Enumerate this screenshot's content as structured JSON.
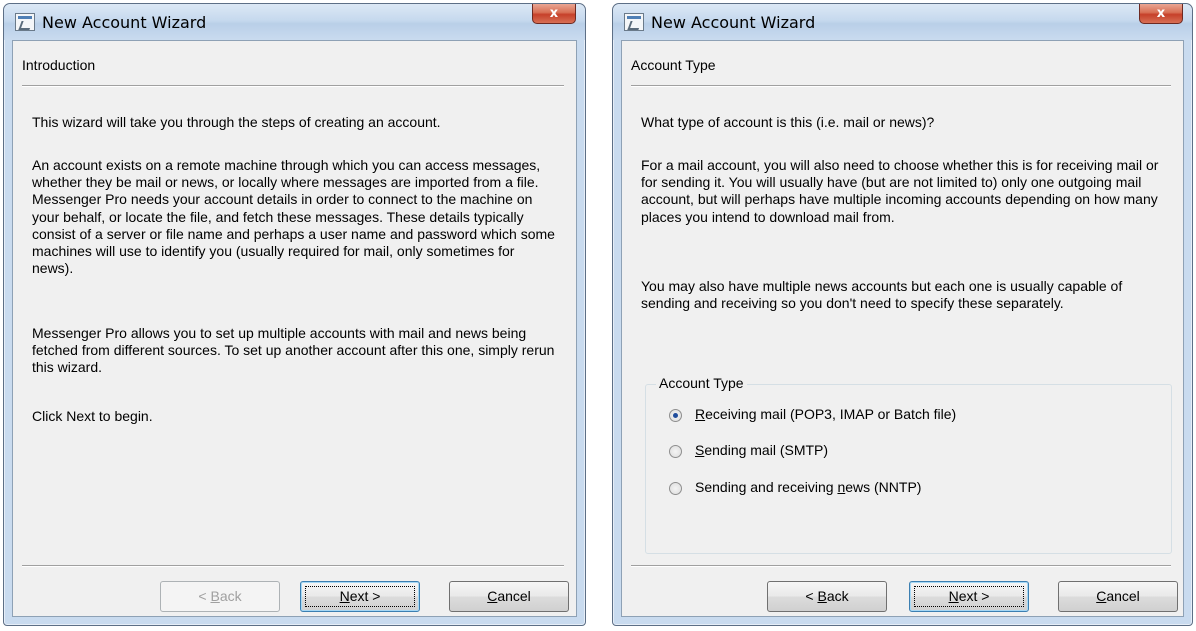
{
  "windows": [
    {
      "title": "New Account Wizard",
      "close_label": "x",
      "page_header": "Introduction",
      "paragraphs": [
        "This wizard will take you through the steps of creating an account.",
        "An account exists on a remote machine through which you can access messages, whether they be mail or news, or locally where messages are imported from a file.  Messenger Pro needs your account details in order to connect to the machine on your behalf, or locate the file, and fetch these messages.  These details typically consist of a server or file name and perhaps a user name and password which some machines will use to identify you (usually required for mail, only sometimes for news).",
        "Messenger Pro allows you to set up multiple accounts with mail and news being fetched from different sources.  To set up another account after this one, simply rerun this wizard.",
        "Click Next to begin."
      ],
      "buttons": {
        "back": {
          "label": "< Back",
          "mnemonic": "B",
          "enabled": false
        },
        "next": {
          "label": "Next >",
          "mnemonic": "N",
          "default": true
        },
        "cancel": {
          "label": "Cancel",
          "mnemonic": "C"
        }
      }
    },
    {
      "title": "New Account Wizard",
      "close_label": "x",
      "page_header": "Account Type",
      "paragraphs": [
        "What type of account is this (i.e. mail or news)?",
        "For a mail account, you will also need to choose whether this is for receiving mail or for sending it.  You will usually have (but are not limited to) only one outgoing mail account, but will perhaps have multiple incoming accounts depending on how many places you intend to download mail from.",
        "You may also have multiple news accounts but each one is usually capable of sending and receiving so you don't need to specify these separately."
      ],
      "group": {
        "label": "Account Type",
        "options": [
          {
            "label": "Receiving mail (POP3, IMAP or Batch file)",
            "mnemonic": "R",
            "checked": true
          },
          {
            "label": "Sending mail (SMTP)",
            "mnemonic": "S",
            "checked": false
          },
          {
            "label": "Sending and receiving news (NNTP)",
            "mnemonic": "n",
            "checked": false
          }
        ]
      },
      "buttons": {
        "back": {
          "label": "< Back",
          "mnemonic": "B",
          "enabled": true
        },
        "next": {
          "label": "Next >",
          "mnemonic": "N",
          "default": true
        },
        "cancel": {
          "label": "Cancel",
          "mnemonic": "C"
        }
      }
    }
  ]
}
